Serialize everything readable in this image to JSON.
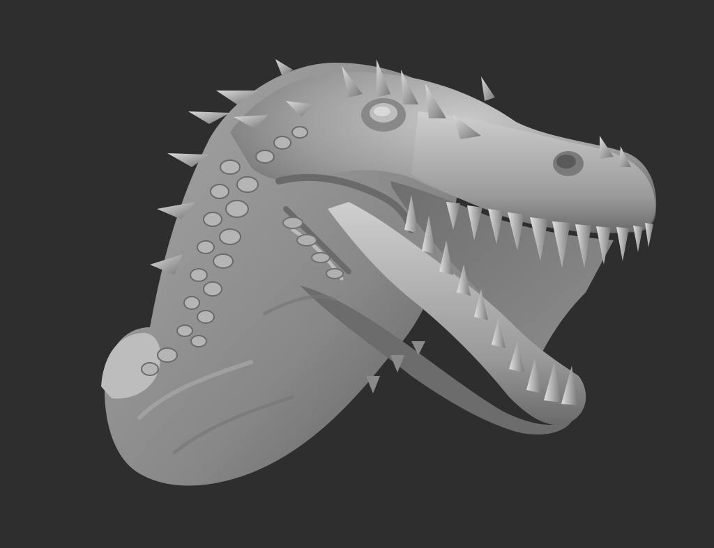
{
  "viewport": {
    "background_color": "#2e2e2e",
    "subject": "sculpted-dinosaur-head-render",
    "material_color": "#9a9a9a",
    "shadow_color": "#4a4a4a",
    "highlight_color": "#d8d8d8"
  }
}
